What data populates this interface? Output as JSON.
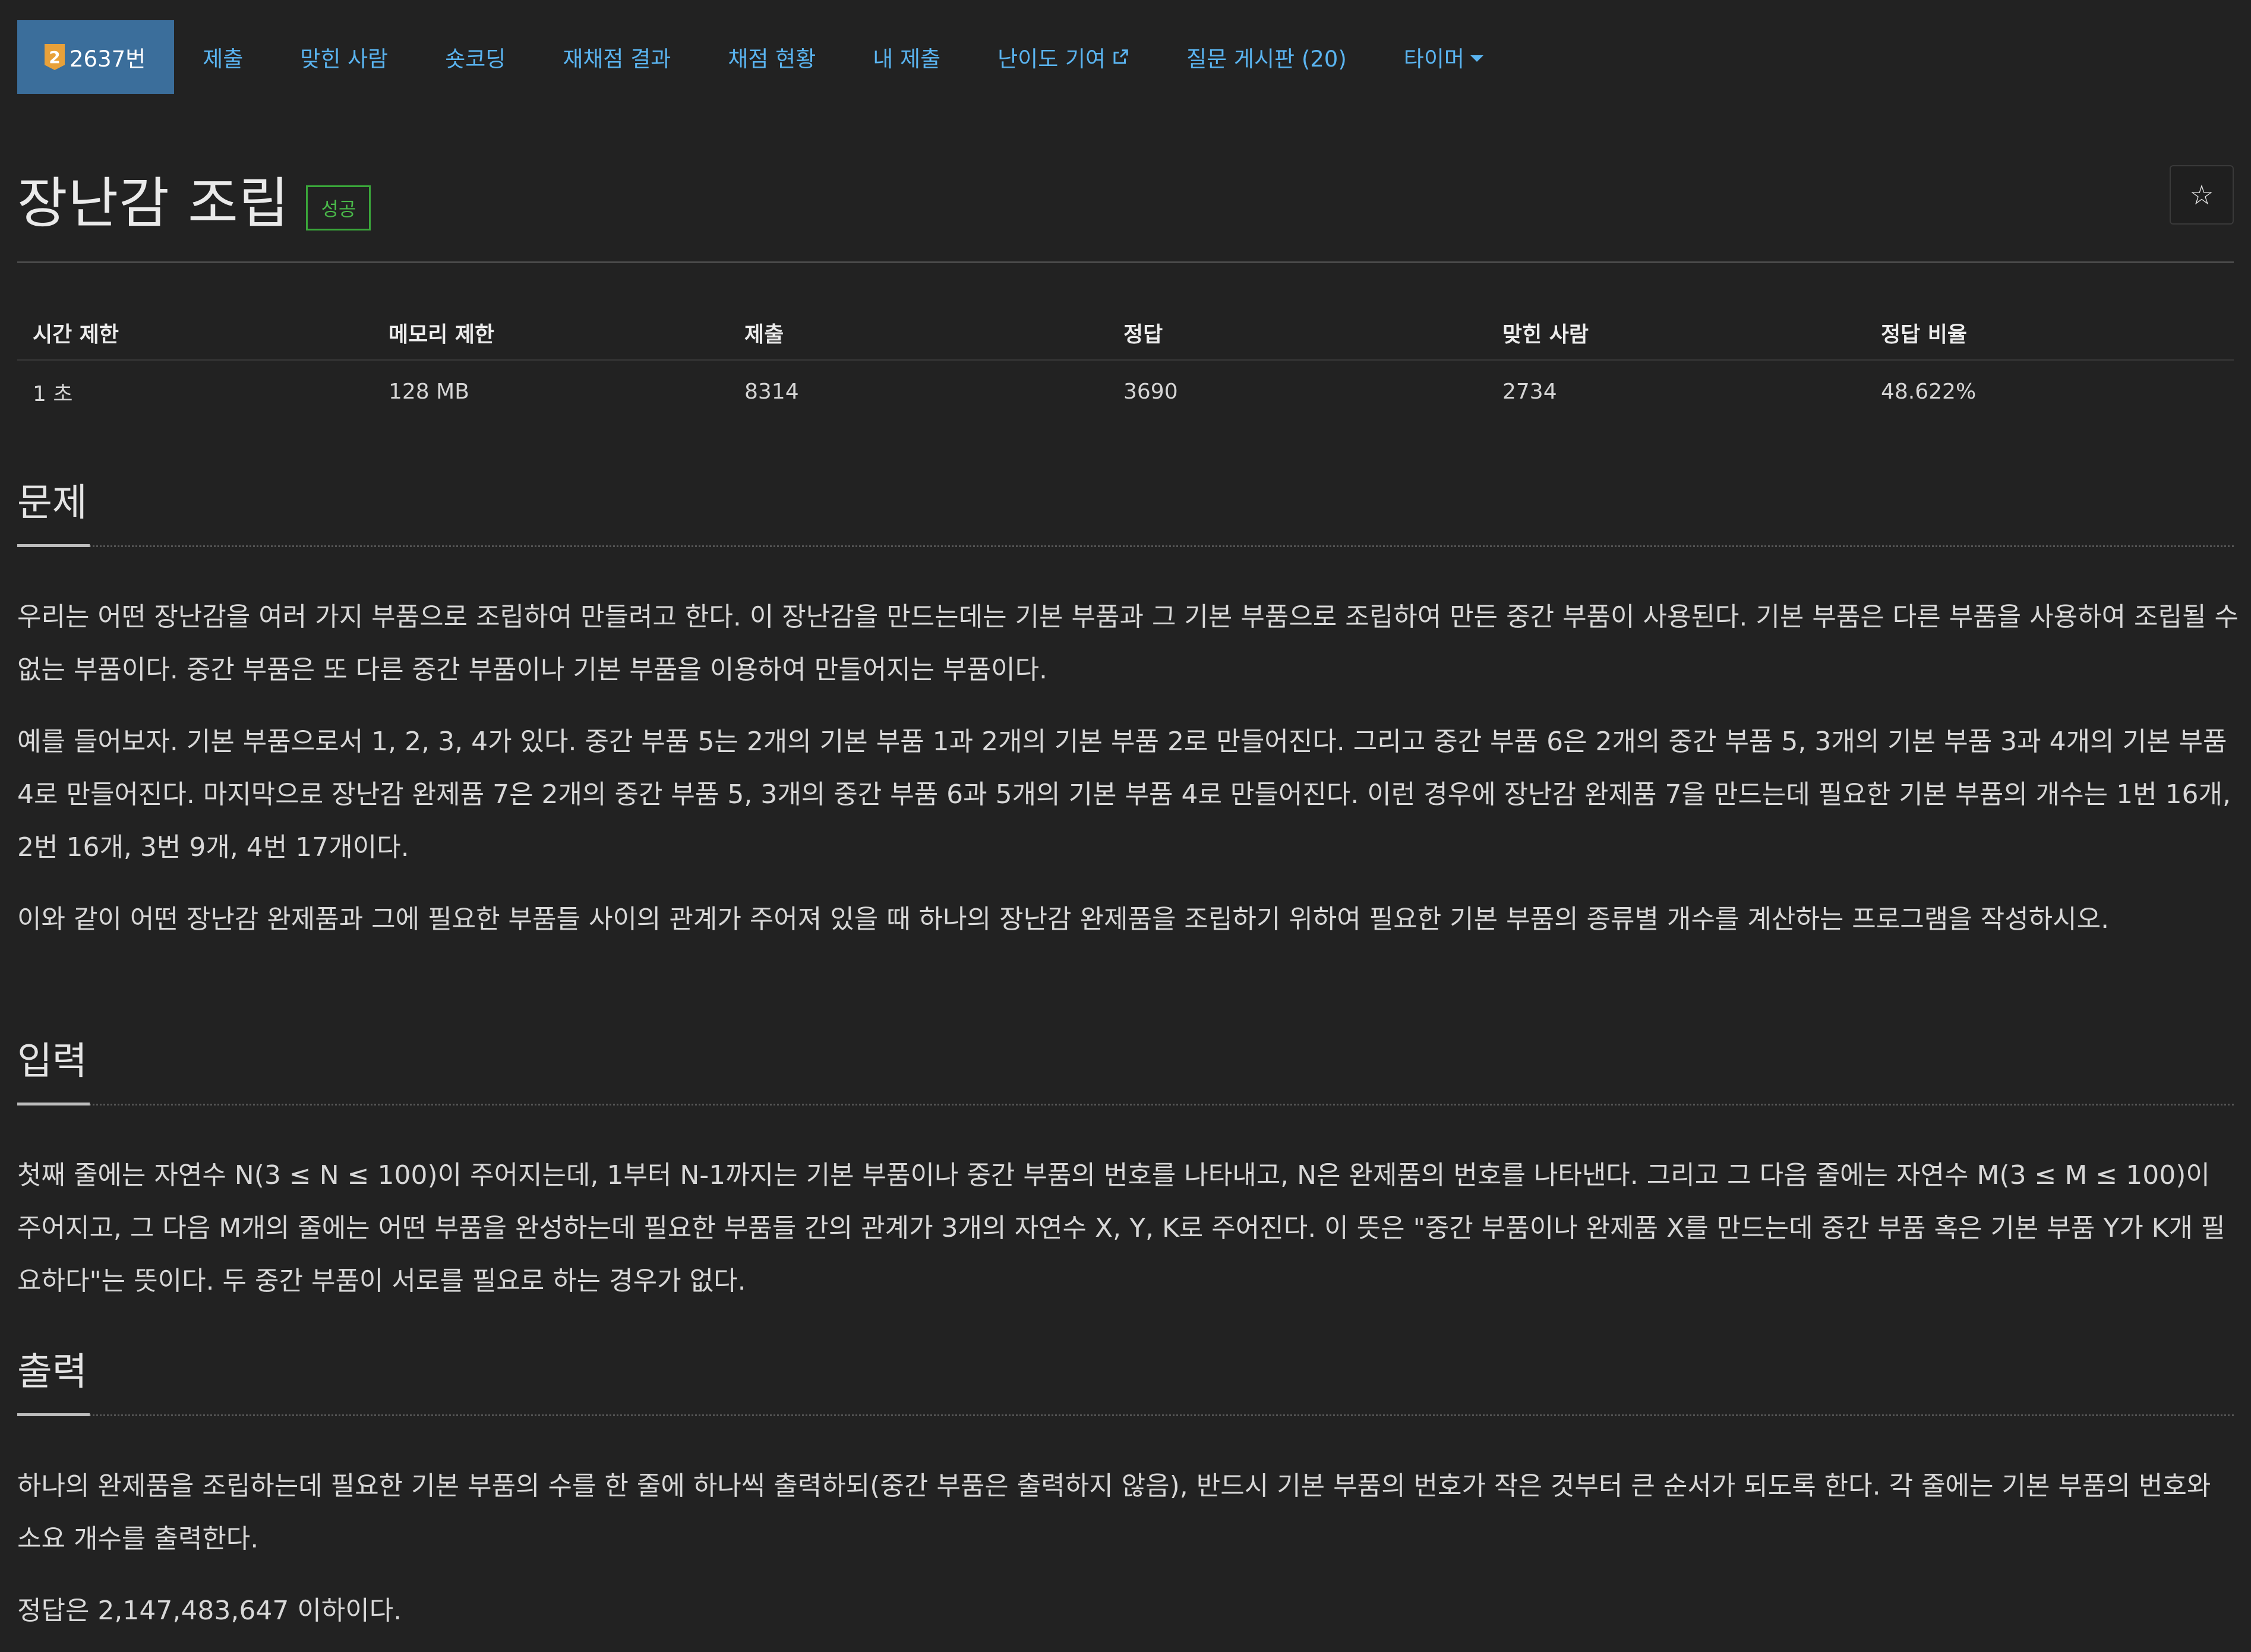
{
  "nav": {
    "problem_id": "2637번",
    "tier_label": "2",
    "items": {
      "submit": "제출",
      "solvers": "맞힌 사람",
      "short_coding": "숏코딩",
      "rejudge": "재채점 결과",
      "judge_status": "채점 현황",
      "my_submissions": "내 제출",
      "difficulty": "난이도 기여",
      "board": "질문 게시판 (20)",
      "timer": "타이머"
    }
  },
  "problem": {
    "title": "장난감 조립",
    "status_badge": "성공",
    "star": "☆"
  },
  "info": {
    "headers": [
      "시간 제한",
      "메모리 제한",
      "제출",
      "정답",
      "맞힌 사람",
      "정답 비율"
    ],
    "values": [
      "1 초",
      "128 MB",
      "8314",
      "3690",
      "2734",
      "48.622%"
    ]
  },
  "sections": {
    "problem_title": "문제",
    "problem_p1": "우리는 어떤 장난감을 여러 가지 부품으로 조립하여 만들려고 한다. 이 장난감을 만드는데는 기본 부품과 그 기본 부품으로 조립하여 만든 중간 부품이 사용된다. 기본 부품은 다른 부품을 사용하여 조립될 수 없는 부품이다. 중간 부품은 또 다른 중간 부품이나 기본 부품을 이용하여 만들어지는 부품이다.",
    "problem_p2": "예를 들어보자. 기본 부품으로서 1, 2, 3, 4가 있다. 중간 부품 5는 2개의 기본 부품 1과 2개의 기본 부품 2로 만들어진다. 그리고 중간 부품 6은 2개의 중간 부품 5, 3개의 기본 부품 3과 4개의 기본 부품 4로 만들어진다. 마지막으로 장난감 완제품 7은 2개의 중간 부품 5, 3개의 중간 부품 6과 5개의 기본 부품 4로 만들어진다. 이런 경우에 장난감 완제품 7을 만드는데 필요한 기본 부품의 개수는 1번 16개, 2번 16개, 3번 9개, 4번 17개이다.",
    "problem_p3": "이와 같이 어떤 장난감 완제품과 그에 필요한 부품들 사이의 관계가 주어져 있을 때 하나의 장난감 완제품을 조립하기 위하여 필요한 기본 부품의 종류별 개수를 계산하는 프로그램을 작성하시오.",
    "input_title": "입력",
    "input_p1": "첫째 줄에는 자연수 N(3 ≤ N ≤ 100)이 주어지는데, 1부터 N-1까지는 기본 부품이나 중간 부품의 번호를 나타내고, N은 완제품의 번호를 나타낸다. 그리고 그 다음 줄에는 자연수 M(3 ≤ M ≤ 100)이 주어지고, 그 다음 M개의 줄에는 어떤 부품을 완성하는데 필요한 부품들 간의 관계가 3개의 자연수 X, Y, K로 주어진다. 이 뜻은 \"중간 부품이나 완제품 X를 만드는데 중간 부품 혹은 기본 부품 Y가 K개 필요하다\"는 뜻이다. 두 중간 부품이 서로를 필요로 하는 경우가 없다.",
    "output_title": "출력",
    "output_p1": "하나의 완제품을 조립하는데 필요한 기본 부품의 수를 한 줄에 하나씩 출력하되(중간 부품은 출력하지 않음), 반드시 기본 부품의 번호가 작은 것부터 큰 순서가 되도록 한다. 각 줄에는 기본 부품의 번호와 소요 개수를 출력한다.",
    "output_p2": "정답은 2,147,483,647 이하이다."
  },
  "colors": {
    "background": "#222222",
    "link": "#5ab4f0",
    "active_tab": "#3b6e9b",
    "success": "#49b849",
    "tier_gold": "#e8a13a"
  }
}
